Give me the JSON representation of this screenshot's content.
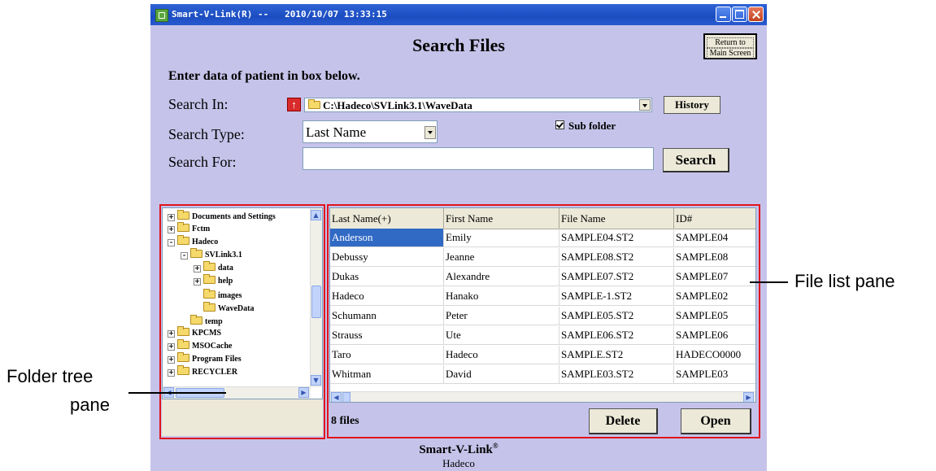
{
  "window": {
    "title": "Smart-V-Link(R) --   2010/10/07 13:33:15",
    "page_title": "Search Files",
    "return_button_line1": "Return to",
    "return_button_line2": "Main Screen"
  },
  "form": {
    "instruction": "Enter data of patient in box below.",
    "search_in_label": "Search In:",
    "search_in_path": "C:\\Hadeco\\SVLink3.1\\WaveData",
    "history_label": "History",
    "search_type_label": "Search Type:",
    "search_type_value": "Last Name",
    "subfolder_label": "Sub folder",
    "subfolder_checked": true,
    "search_for_label": "Search For:",
    "search_for_value": "",
    "search_button": "Search"
  },
  "tree": {
    "items": [
      {
        "label": "Documents and Settings",
        "expander": "+"
      },
      {
        "label": "Fctm",
        "expander": "+"
      },
      {
        "label": "Hadeco",
        "expander": "-"
      },
      {
        "label": "SVLink3.1",
        "expander": "-"
      },
      {
        "label": "data",
        "expander": "+"
      },
      {
        "label": "help",
        "expander": "+"
      },
      {
        "label": "images",
        "expander": ""
      },
      {
        "label": "WaveData",
        "expander": ""
      },
      {
        "label": "temp",
        "expander": ""
      },
      {
        "label": "KPCMS",
        "expander": "+"
      },
      {
        "label": "MSOCache",
        "expander": "+"
      },
      {
        "label": "Program Files",
        "expander": "+"
      },
      {
        "label": "RECYCLER",
        "expander": "+"
      }
    ]
  },
  "file_list": {
    "columns": [
      "Last Name(+)",
      "First Name",
      "File Name",
      "ID#"
    ],
    "rows": [
      [
        "Anderson",
        "Emily",
        "SAMPLE04.ST2",
        "SAMPLE04"
      ],
      [
        "Debussy",
        "Jeanne",
        "SAMPLE08.ST2",
        "SAMPLE08"
      ],
      [
        "Dukas",
        "Alexandre",
        "SAMPLE07.ST2",
        "SAMPLE07"
      ],
      [
        "Hadeco",
        "Hanako",
        "SAMPLE-1.ST2",
        "SAMPLE02"
      ],
      [
        "Schumann",
        "Peter",
        "SAMPLE05.ST2",
        "SAMPLE05"
      ],
      [
        "Strauss",
        "Ute",
        "SAMPLE06.ST2",
        "SAMPLE06"
      ],
      [
        "Taro",
        "Hadeco",
        "SAMPLE.ST2",
        "HADECO0000"
      ],
      [
        "Whitman",
        "David",
        "SAMPLE03.ST2",
        "SAMPLE03"
      ]
    ],
    "files_count": "8 files",
    "delete_label": "Delete",
    "open_label": "Open"
  },
  "footer": {
    "brand": "Smart-V-Link",
    "brand_mark": "(R)",
    "company": "Hadeco"
  },
  "annotations": {
    "file_list_pane": "File list pane",
    "folder_tree_line1": "Folder tree",
    "folder_tree_line2": "pane"
  },
  "colors": {
    "window_bg": "#c6c3ea",
    "title_bar": "#2f63d6",
    "selection": "#316ac5",
    "annotation_red": "#e0141e"
  }
}
